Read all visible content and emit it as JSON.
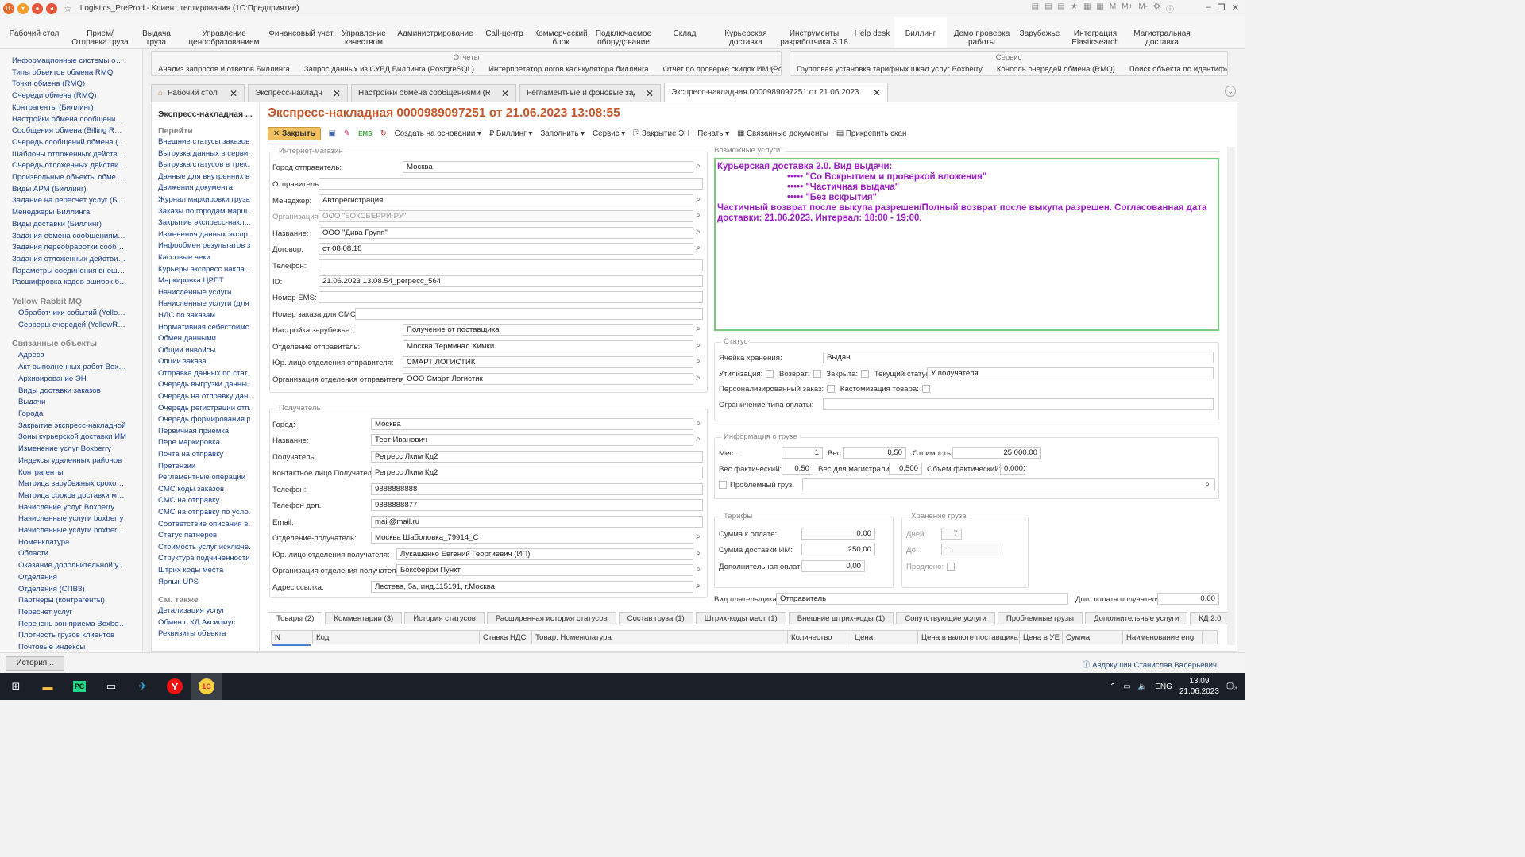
{
  "window": {
    "title": "Logistics_PreProd - Клиент тестирования (1С:Предприятие)",
    "tools": [
      "M",
      "M+",
      "M-"
    ]
  },
  "sections": [
    "Рабочий стол",
    "Прием/Отправка груза",
    "Выдача груза",
    "Управление ценообразованием",
    "Финансовый учет",
    "Управление качеством",
    "Администрирование",
    "Call-центр",
    "Коммерческий блок",
    "Подключаемое оборудование",
    "Склад",
    "Курьерская доставка",
    "Инструменты разработчика 3.18",
    "Help desk",
    "Биллинг",
    "Демо проверка работы",
    "Зарубежье",
    "Интеграция Elasticsearch",
    "Магистральная доставка"
  ],
  "leftnav": {
    "items": [
      "Информационные системы обм...",
      "Типы объектов обмена RMQ",
      "Точки обмена (RMQ)",
      "Очереди обмена (RMQ)",
      "Контрагенты (Биллинг)",
      "Настройки обмена сообщениям...",
      "Сообщения обмена (Billing RMQ)",
      "Очередь сообщений обмена (R...",
      "Шаблоны отложенных действий ...",
      "Очередь отложенных действий (...",
      "Произвольные объекты обмена...",
      "Виды АРМ (Биллинг)",
      "Задание на пересчет услуг (Бил...",
      "Менеджеры Биллинга",
      "Виды доставки (Биллинг)",
      "Задания обмена сообщениями (...",
      "Задания переобработки сообще...",
      "Задания отложенных действий (...",
      "Параметры соединения внешни...",
      "Расшифровка кодов ошибок би..."
    ],
    "group1": "Yellow Rabbit MQ",
    "group1_items": [
      "Обработчики событий (Yellow...",
      "Серверы очередей (YellowRab..."
    ],
    "group2": "Связанные объекты",
    "group2_items": [
      "Адреса",
      "Акт выполненных работ Boxbe...",
      "Архивирование ЭН",
      "Виды доставки заказов",
      "Выдачи",
      "Города",
      "Закрытие экспресс-накладной",
      "Зоны курьерской доставки ИМ",
      "Изменение услуг Boxberry",
      "Индексы удаленных районов",
      "Контрагенты",
      "Матрица зарубежных сроков ...",
      "Матрица сроков доставки ме...",
      "Начисление услуг Boxberry",
      "Начисленные услуги boxberry",
      "Начисленные услуги boxberry (...",
      "Номенклатура",
      "Области",
      "Оказание дополнительной ус...",
      "Отделения",
      "Отделения (СПВЗ)",
      "Партнеры (контрагенты)",
      "Пересчет услуг",
      "Перечень зон приема Boxberry",
      "Плотность грузов клиентов",
      "Почтовые индексы"
    ]
  },
  "reports": {
    "header": "Отчеты",
    "items": [
      "Анализ запросов и ответов Биллинга",
      "Запрос данных из СУБД Биллинга (PostgreSQL)",
      "Интерпретатор логов калькулятора биллинга",
      "Отчет по проверке скидок ИМ (Postgr..."
    ]
  },
  "service": {
    "header": "Сервис",
    "items": [
      "Групповая установка тарифных шкал услуг Boxberry",
      "Консоль очередей обмена (RMQ)",
      "Поиск объекта по идентифи..."
    ]
  },
  "tabs": [
    "Рабочий стол",
    "Экспресс-накладная",
    "Настройки обмена сообщениями (RMQ)",
    "Регламентные и фоновые задания",
    "Экспресс-накладная 0000989097251 от 21.06.2023 13:08:55"
  ],
  "formnav": {
    "header": "Экспресс-накладная ...",
    "go": "Перейти",
    "items": [
      "Внешние статусы заказов",
      "Выгрузка данных в серви...",
      "Выгрузка статусов в трек...",
      "Данные для внутренних в...",
      "Движения документа",
      "Журнал маркировки груза",
      "Заказы по городам марш...",
      "Закрытие экспресс-накл...",
      "Изменения данных экспр...",
      "Инфообмен результатов з...",
      "Кассовые чеки",
      "Курьеры экспресс накла...",
      "Маркировка ЦРПТ",
      "Начисленные услуги",
      "Начисленные услуги (для ...",
      "НДС по заказам",
      "Нормативная себестоимо...",
      "Обмен данными",
      "Общии инвойсы",
      "Опции заказа",
      "Отправка данных по стат...",
      "Очередь выгрузки данны...",
      "Очередь на отправку дан...",
      "Очередь регистрации отп...",
      "Очередь формирования р...",
      "Первичная приемка",
      "Пере маркировка",
      "Почта на отправку",
      "Претензии",
      "Регламентные операции",
      "СМС коды заказов",
      "СМС на отправку",
      "СМС на отправку по усло...",
      "Соответствие описания в...",
      "Статус патнеров",
      "Стоимость услуг исключе...",
      "Структура подчиненности",
      "Штрих коды места",
      "Ярлык UPS"
    ],
    "seealso": "См. также",
    "seealso_items": [
      "Детализация услуг",
      "Обмен с КД Аксиомус",
      "Реквизиты объекта"
    ]
  },
  "doc": {
    "title": "Экспресс-накладная 0000989097251 от 21.06.2023 13:08:55"
  },
  "cmd": {
    "close": "Закрыть",
    "create": "Создать на основании",
    "billing": "Биллинг",
    "fill": "Заполнить",
    "service": "Сервис",
    "closeen": "Закрытие ЭН",
    "print": "Печать",
    "docs": "Связанные документы",
    "scan": "Прикрепить скан"
  },
  "shop": {
    "title": "Интернет-магазин",
    "rows": [
      [
        "Город отправитель:",
        "Москва"
      ],
      [
        "Отправитель:",
        ""
      ],
      [
        "Менеджер:",
        "Авторегистрация"
      ],
      [
        "Организация:",
        "ООО \"БОКСБЕРРИ РУ\""
      ],
      [
        "Название:",
        "ООО \"Дива Групп\""
      ],
      [
        "Договор:",
        "от 08.08.18"
      ],
      [
        "Телефон:",
        ""
      ],
      [
        "ID:",
        "21.06.2023 13.08.54_регресс_564"
      ],
      [
        "Номер EMS:",
        ""
      ],
      [
        "Номер заказа для СМС:",
        ""
      ],
      [
        "Настройка зарубежье:",
        "Получение от поставщика"
      ],
      [
        "Отделение отправитель:",
        "Москва Терминал Химки"
      ],
      [
        "Юр. лицо отделения отправителя:",
        "СМАРТ ЛОГИСТИК"
      ],
      [
        "Организация отделения отправителя:",
        "ООО Смарт-Логистик"
      ]
    ]
  },
  "recipient": {
    "title": "Получатель",
    "rows": [
      [
        "Город:",
        "Москва"
      ],
      [
        "Название:",
        "Тест Иванович"
      ],
      [
        "Получатель:",
        "Регресс Лким Кд2"
      ],
      [
        "Контактное лицо Получателя:",
        "Регресс Лким Кд2"
      ],
      [
        "Телефон:",
        "9888888888"
      ],
      [
        "Телефон доп.:",
        "9888888877"
      ],
      [
        "Email:",
        "mail@mail.ru"
      ],
      [
        "Отделение-получатель:",
        "Москва Шаболовка_79914_С"
      ],
      [
        "Юр. лицо отделения получателя:",
        "Лукашенко Евгений Георгиевич (ИП)"
      ],
      [
        "Организация отделения получателя:",
        "Боксберри Пункт"
      ],
      [
        "Адрес ссылка:",
        "Лестева, 5а, инд.115191, г.Москва"
      ]
    ]
  },
  "services": {
    "title": "Возможные услуги",
    "lines": [
      "Курьерская доставка 2.0. Вид выдачи:",
      "••••• \"Со Вскрытием и проверкой вложения\"",
      "••••• \"Частичная выдача\"",
      "••••• \"Без вскрытия\"",
      "Частичный возврат после выкупа разрешен/Полный возврат после выкупа разрешен. Согласованная дата доставки: 21.06.2023. Интервал: 18:00 - 19:00."
    ]
  },
  "status": {
    "title": "Статус",
    "cell_label": "Ячейка хранения:",
    "cell": "Выдан",
    "util": "Утилизация:",
    "ret": "Возврат:",
    "closed": "Закрыта:",
    "cur_label": "Текущий статус:",
    "cur": "У получателя",
    "pers": "Персонализированный заказ:",
    "cust": "Кастомизация товара:",
    "paylim": "Ограничение типа оплаты:"
  },
  "cargo": {
    "title": "Информация о грузе",
    "places_l": "Мест:",
    "places": "1",
    "weight_l": "Вес:",
    "weight": "0,50",
    "cost_l": "Стоимость:",
    "cost": "25 000,00",
    "wfact_l": "Вес фактический:",
    "wfact": "0,50",
    "wmag_l": "Вес для магистрали:",
    "wmag": "0,500",
    "vol_l": "Объем фактический:",
    "vol": "0,0001",
    "prob": "Проблемный груз"
  },
  "tariffs": {
    "title": "Тарифы",
    "pay_l": "Сумма к оплате:",
    "pay": "0,00",
    "deliv_l": "Сумма доставки ИМ:",
    "deliv": "250,00",
    "extra_l": "Дополнительная оплата:",
    "extra": "0,00"
  },
  "storage": {
    "title": "Хранение груза",
    "days_l": "Дней:",
    "days": "7",
    "to_l": "До:",
    "to": ". .",
    "ext_l": "Продлено:"
  },
  "payer": {
    "label": "Вид плательщика:",
    "value": "Отправитель",
    "extra_l": "Доп. оплата получателя:",
    "extra": "0,00"
  },
  "btabs": [
    "Товары (2)",
    "Комментарии (3)",
    "История статусов",
    "Расширенная история статусов",
    "Состав груза (1)",
    "Штрих-коды мест (1)",
    "Внешние штрих-коды (1)",
    "Сопутствующие услуги",
    "Проблемные грузы",
    "Дополнительные услуги",
    "КД 2.0"
  ],
  "tblcols": [
    "N",
    "Код",
    "Ставка НДС",
    "Товар, Номенклатура",
    "Количество",
    "Цена",
    "Цена в валюте поставщика",
    "Цена в УЕ",
    "Сумма",
    "Наименование eng"
  ],
  "statusbar": {
    "history": "История...",
    "user": "Авдокушин Станислав Валерьевич"
  },
  "tray": {
    "lang": "ENG",
    "time": "13:09",
    "date": "21.06.2023",
    "badge": "3"
  }
}
